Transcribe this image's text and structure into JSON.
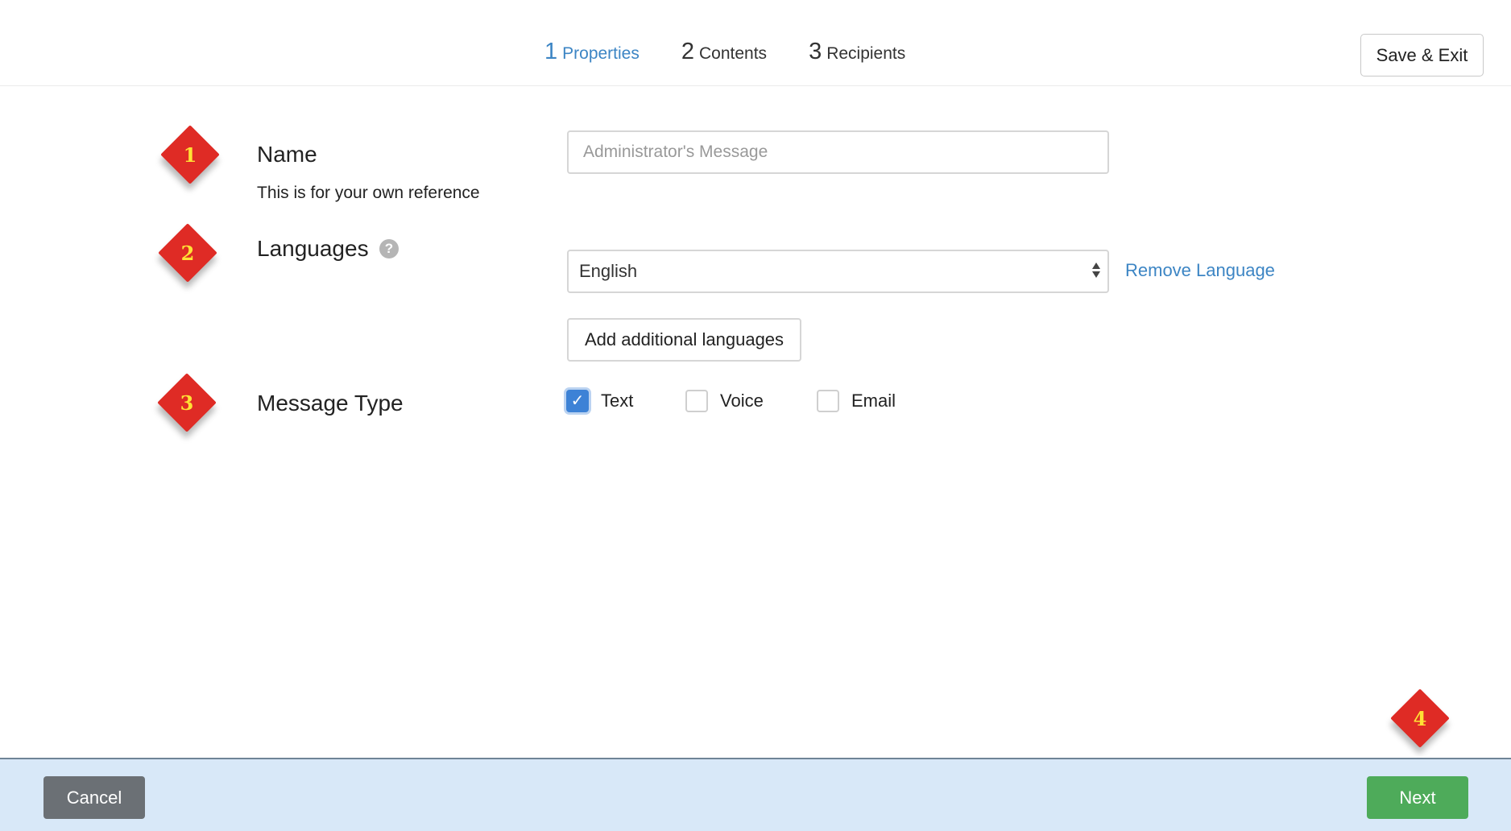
{
  "header": {
    "steps": [
      {
        "number": "1",
        "label": "Properties",
        "active": true
      },
      {
        "number": "2",
        "label": "Contents",
        "active": false
      },
      {
        "number": "3",
        "label": "Recipients",
        "active": false
      }
    ],
    "save_exit_label": "Save & Exit"
  },
  "markers": [
    "1",
    "2",
    "3",
    "4"
  ],
  "form": {
    "name": {
      "label": "Name",
      "sublabel": "This is for your own reference",
      "placeholder": "Administrator's Message",
      "value": ""
    },
    "languages": {
      "label": "Languages",
      "help_icon": "?",
      "selected": "English",
      "remove_label": "Remove Language",
      "add_label": "Add additional languages"
    },
    "message_type": {
      "label": "Message Type",
      "options": [
        {
          "label": "Text",
          "checked": true
        },
        {
          "label": "Voice",
          "checked": false
        },
        {
          "label": "Email",
          "checked": false
        }
      ]
    }
  },
  "footer": {
    "cancel_label": "Cancel",
    "next_label": "Next"
  },
  "colors": {
    "accent": "#3c85c4",
    "marker": "#df2b25",
    "marker_text": "#ffe135",
    "next": "#4eab5a",
    "cancel": "#6b7075",
    "footer_bg": "#d8e8f8"
  },
  "icons": {
    "help": "question-circle-icon",
    "check": "checkmark-icon",
    "select_arrows": "updown-arrows-icon"
  }
}
